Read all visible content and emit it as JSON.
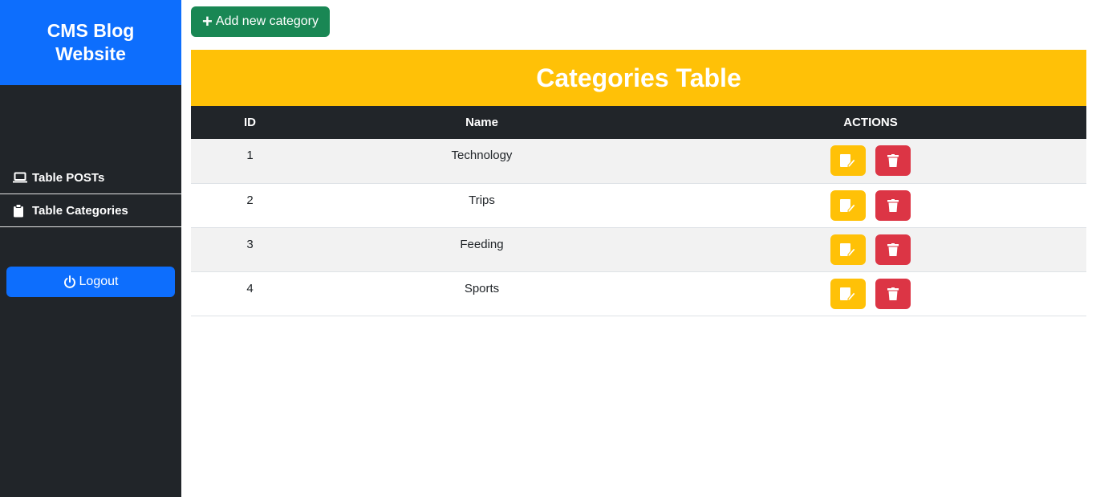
{
  "sidebar": {
    "brand": "CMS Blog Website",
    "items": [
      {
        "label": "Table POSTs",
        "icon": "laptop-icon"
      },
      {
        "label": "Table Categories",
        "icon": "clipboard-icon"
      }
    ],
    "logout_label": "Logout"
  },
  "toolbar": {
    "add_label": "Add new category"
  },
  "table": {
    "title": "Categories Table",
    "headers": [
      "ID",
      "Name",
      "ACTIONS"
    ],
    "rows": [
      {
        "id": "1",
        "name": "Technology"
      },
      {
        "id": "2",
        "name": "Trips"
      },
      {
        "id": "3",
        "name": "Feeding"
      },
      {
        "id": "4",
        "name": "Sports"
      }
    ]
  },
  "colors": {
    "brand": "#0d6efd",
    "sidebar": "#212529",
    "add": "#198754",
    "header": "#ffc107",
    "edit": "#ffc107",
    "delete": "#dc3545"
  }
}
